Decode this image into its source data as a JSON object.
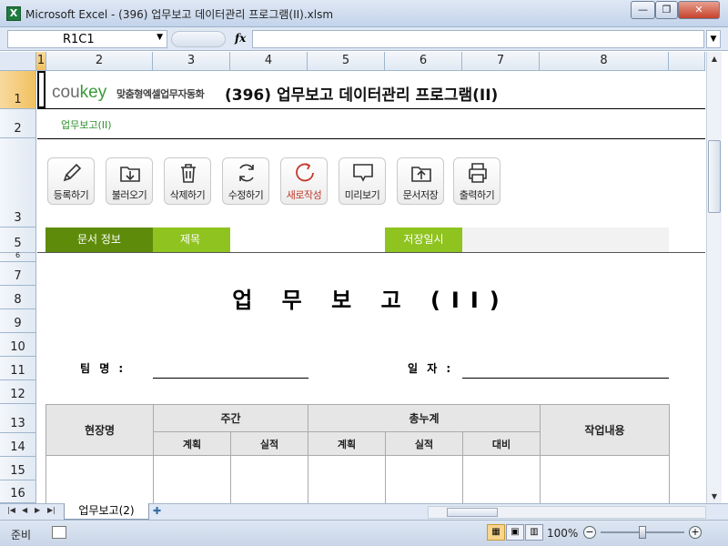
{
  "window": {
    "title": "Microsoft Excel - (396) 업무보고 데이터관리 프로그램(II).xlsm",
    "app_icon": "X",
    "controls": [
      "minimize-icon",
      "restore-icon",
      "close-icon"
    ]
  },
  "formula_bar": {
    "name_box": "R1C1",
    "fx_label": "fx",
    "formula": ""
  },
  "columns": [
    "1",
    "2",
    "3",
    "4",
    "5",
    "6",
    "7",
    "8"
  ],
  "rows": [
    "1",
    "2",
    "3",
    "5",
    "6",
    "7",
    "8",
    "9",
    "10",
    "11",
    "12",
    "13",
    "14",
    "15",
    "16"
  ],
  "header": {
    "logo_main": "cou",
    "logo_accent": "key",
    "logo_sub": "맞춤형엑셀업무자동화",
    "program_title": "(396) 업무보고 데이터관리 프로그램(II)",
    "breadcrumb": "업무보고(II)"
  },
  "toolbar": [
    {
      "label": "등록하기",
      "icon": "pencil-icon"
    },
    {
      "label": "불러오기",
      "icon": "load-icon"
    },
    {
      "label": "삭제하기",
      "icon": "trash-icon"
    },
    {
      "label": "수정하기",
      "icon": "refresh-icon"
    },
    {
      "label": "새로작성",
      "icon": "new-document-icon"
    },
    {
      "label": "미리보기",
      "icon": "preview-icon"
    },
    {
      "label": "문서저장",
      "icon": "save-upload-icon"
    },
    {
      "label": "출력하기",
      "icon": "printer-icon"
    }
  ],
  "info_bar": {
    "doc_info": "문서 정보",
    "title_label": "제목",
    "title_value": "",
    "date_label": "저장일시",
    "date_value": ""
  },
  "document": {
    "title": "업 무 보 고 (II)",
    "team_label": "팀 명 :",
    "team_value": "",
    "date_label": "일 자 :",
    "date_value": ""
  },
  "table": {
    "site": "현장명",
    "weekly": "주간",
    "cumulative": "총누계",
    "work": "작업내용",
    "plan": "계획",
    "actual": "실적",
    "plan2": "계획",
    "actual2": "실적",
    "ratio": "대비"
  },
  "sheet_tabs": {
    "active": "업무보고(2)"
  },
  "status": {
    "ready": "준비",
    "zoom": "100%"
  },
  "colors": {
    "green_dark": "#5f8b0a",
    "green_light": "#8fc31f",
    "logo_green": "#3a9a39"
  }
}
